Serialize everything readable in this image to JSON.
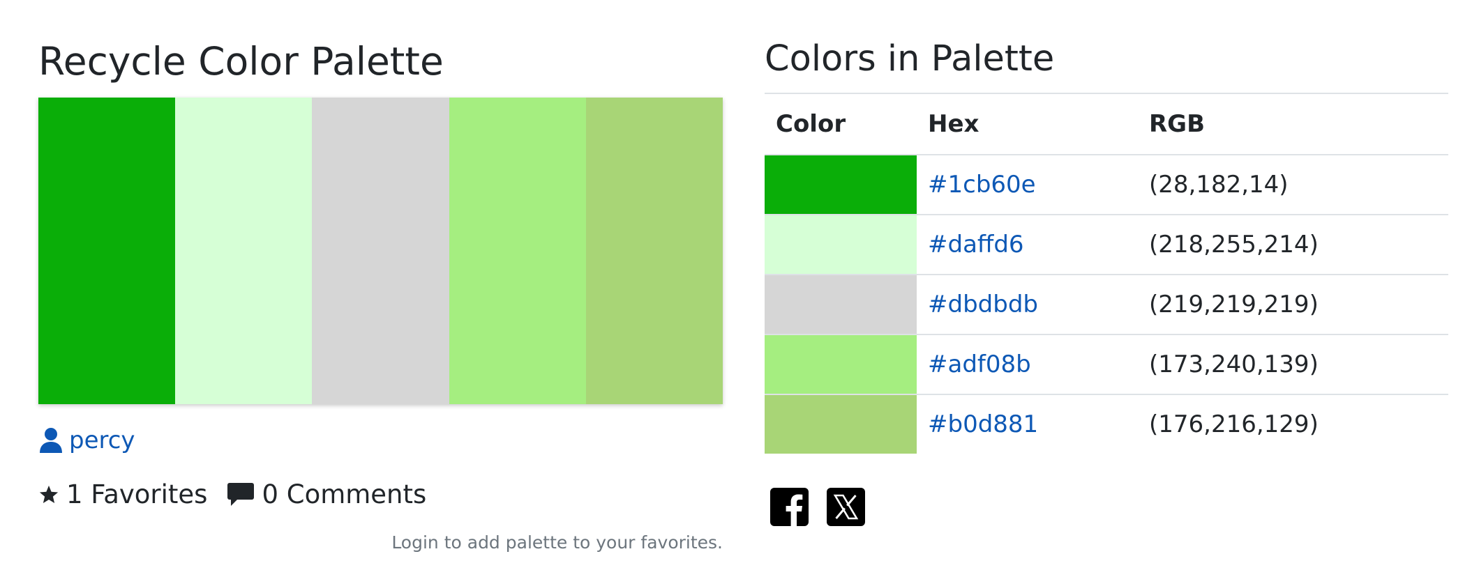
{
  "palette": {
    "title": "Recycle Color Palette",
    "colors": [
      "#0aae08",
      "#d6ffd6",
      "#d6d6d6",
      "#a5ee80",
      "#a8d576"
    ],
    "author": "percy",
    "favorites_text": "1 Favorites",
    "comments_text": "0 Comments",
    "login_note": "Login to add palette to your favorites."
  },
  "colors_table": {
    "title": "Colors in Palette",
    "headers": {
      "color": "Color",
      "hex": "Hex",
      "rgb": "RGB"
    },
    "rows": [
      {
        "swatch": "#0aae08",
        "hex": "#1cb60e",
        "rgb": "(28,182,14)"
      },
      {
        "swatch": "#d6ffd6",
        "hex": "#daffd6",
        "rgb": "(218,255,214)"
      },
      {
        "swatch": "#d6d6d6",
        "hex": "#dbdbdb",
        "rgb": "(219,219,219)"
      },
      {
        "swatch": "#a5ee80",
        "hex": "#adf08b",
        "rgb": "(173,240,139)"
      },
      {
        "swatch": "#a8d576",
        "hex": "#b0d881",
        "rgb": "(176,216,129)"
      }
    ]
  },
  "share": {
    "icons": [
      "facebook-icon",
      "x-icon"
    ]
  },
  "theme": {
    "link_color": "#0d58b5",
    "text_color": "#212529",
    "muted_color": "#6c757d",
    "border_color": "#dee2e6"
  }
}
